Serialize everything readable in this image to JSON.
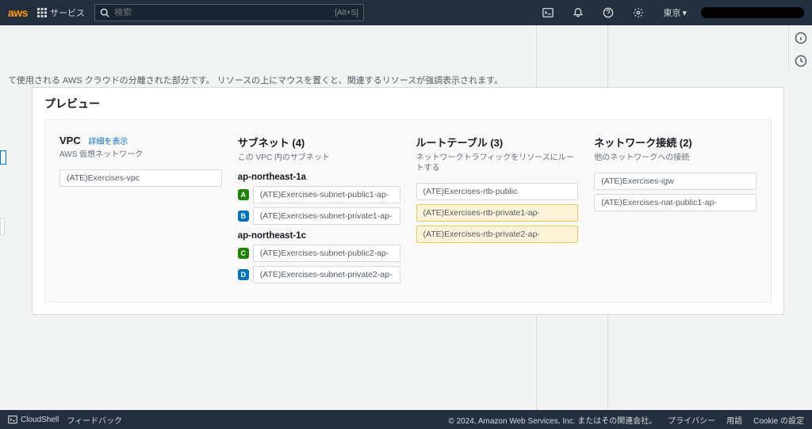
{
  "nav": {
    "logo": "aws",
    "services": "サービス",
    "search_placeholder": "検索",
    "search_shortcut": "[Alt+S]",
    "region": "東京"
  },
  "description": "て使用される AWS クラウドの分離された部分です。 リソースの上にマウスを置くと、関連するリソースが強調表示されます。",
  "preview": {
    "title": "プレビュー",
    "columns": {
      "vpc": {
        "title": "VPC",
        "detail_link": "詳細を表示",
        "subtitle": "AWS 仮想ネットワーク",
        "items": [
          "(ATE)Exercises-vpc"
        ]
      },
      "subnet": {
        "title": "サブネット (4)",
        "subtitle": "この VPC 内のサブネット",
        "azs": [
          {
            "name": "ap-northeast-1a",
            "items": [
              {
                "badge": "A",
                "badge_class": "badge-a",
                "label": "(ATE)Exercises-subnet-public1-ap-"
              },
              {
                "badge": "B",
                "badge_class": "badge-b",
                "label": "(ATE)Exercises-subnet-private1-ap-"
              }
            ]
          },
          {
            "name": "ap-northeast-1c",
            "items": [
              {
                "badge": "C",
                "badge_class": "badge-c",
                "label": "(ATE)Exercises-subnet-public2-ap-"
              },
              {
                "badge": "D",
                "badge_class": "badge-d",
                "label": "(ATE)Exercises-subnet-private2-ap-"
              }
            ]
          }
        ]
      },
      "route_table": {
        "title": "ルートテーブル (3)",
        "subtitle": "ネットワークトラフィックをリソースにルートする",
        "items": [
          {
            "label": "(ATE)Exercises-rtb-public",
            "highlighted": false
          },
          {
            "label": "(ATE)Exercises-rtb-private1-ap-",
            "highlighted": true
          },
          {
            "label": "(ATE)Exercises-rtb-private2-ap-",
            "highlighted": true
          }
        ]
      },
      "network": {
        "title": "ネットワーク接続 (2)",
        "subtitle": "他のネットワークへの接続",
        "items": [
          "(ATE)Exercises-igw",
          "(ATE)Exercises-nat-public1-ap-"
        ]
      }
    }
  },
  "footer": {
    "cloudshell": "CloudShell",
    "feedback": "フィードバック",
    "copyright": "© 2024, Amazon Web Services, Inc. またはその関連会社。",
    "privacy": "プライバシー",
    "terms": "用語",
    "cookie": "Cookie の設定"
  }
}
